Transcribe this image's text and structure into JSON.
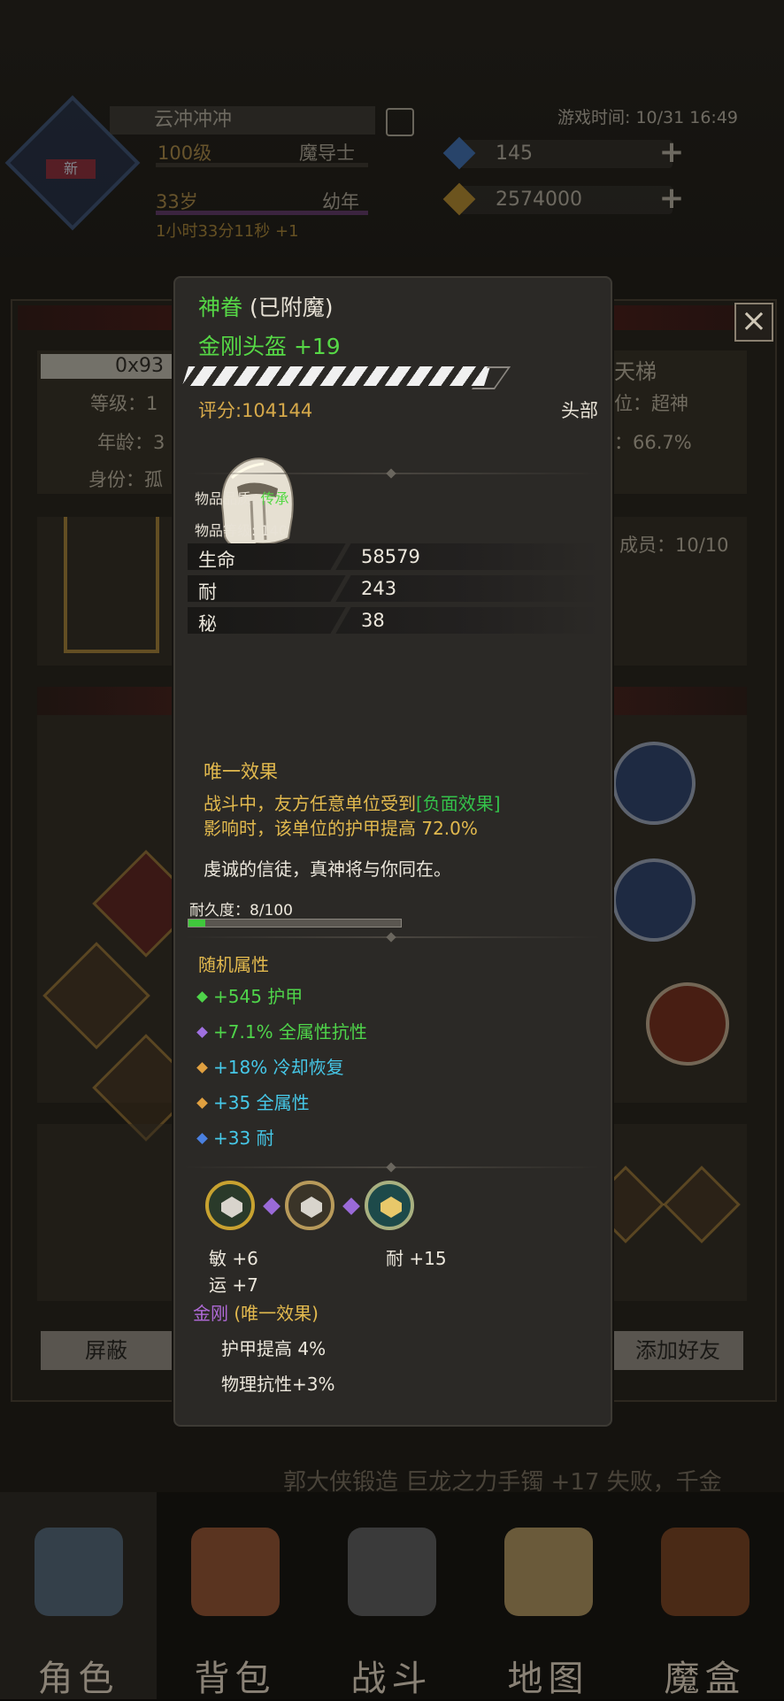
{
  "background": {
    "game_time": "游戏时间: 10/31 16:49",
    "player": {
      "name": "云冲冲冲",
      "level": "100级",
      "class": "魔导士",
      "age": "33岁",
      "stage": "幼年",
      "timer": "1小时33分11秒 +1",
      "badge": "新"
    },
    "resources": [
      {
        "value": "145",
        "icon": "blue-crystal-icon",
        "color": "#3f7fd6"
      },
      {
        "value": "2574000",
        "icon": "gold-crystal-icon",
        "color": "#d6a230"
      }
    ],
    "panel": {
      "id_prefix": "0x93",
      "left_labels": [
        "等级：1",
        "年龄：3",
        "身份：孤"
      ],
      "right_title": "天梯",
      "right_labels": [
        "位：超神",
        "：66.7%"
      ],
      "members": "成员：10/10",
      "buttons": [
        "屏蔽",
        "添加好友"
      ]
    },
    "scroll_message": "郭大侠锻造 巨龙之力手镯 +17 失败，千金",
    "bottom_nav": [
      "角色",
      "背包",
      "战斗",
      "地图",
      "魔盒"
    ]
  },
  "tooltip": {
    "blessing": "神眷",
    "enchant_state": "(已附魔)",
    "item_name": "金刚头盔 +19",
    "score": "评分:104144",
    "slot": "头部",
    "icon": "helmet-icon",
    "quality_label": "物品品质:",
    "quality_value": "传承",
    "item_level": "物品等级: 140",
    "stats": [
      {
        "name": "生命",
        "value": "58579"
      },
      {
        "name": "耐",
        "value": "243"
      },
      {
        "name": "秘",
        "value": "38"
      }
    ],
    "unique_title": "唯一效果",
    "unique_line1_pre": "战斗中，友方任意单位受到",
    "unique_line1_link": "[负面效果]",
    "unique_line2": "影响时，该单位的护甲提高 72.0%",
    "quote": "虔诚的信徒，真神将与你同在。",
    "durability_label": "耐久度：8/100",
    "durability_fraction": 0.08,
    "random_title": "随机属性",
    "random_attrs": [
      {
        "text": "+545 护甲",
        "color": "#4fd44a",
        "gem": "#4fd44a"
      },
      {
        "text": "+7.1% 全属性抗性",
        "color": "#4fd44a",
        "gem": "#a070e0"
      },
      {
        "text": "+18% 冷却恢复",
        "color": "#46c8e8",
        "gem": "#e0a040"
      },
      {
        "text": "+35 全属性",
        "color": "#46c8e8",
        "gem": "#e0a040"
      },
      {
        "text": "+33 耐",
        "color": "#46c8e8",
        "gem": "#4a80e0"
      }
    ],
    "socket_stats": {
      "left1": "敏 +6",
      "left2": "运 +7",
      "right1": "耐 +15"
    },
    "set_name": "金刚",
    "set_suffix": "(唯一效果)",
    "set_lines": [
      "护甲提高 4%",
      "物理抗性+3%"
    ]
  }
}
